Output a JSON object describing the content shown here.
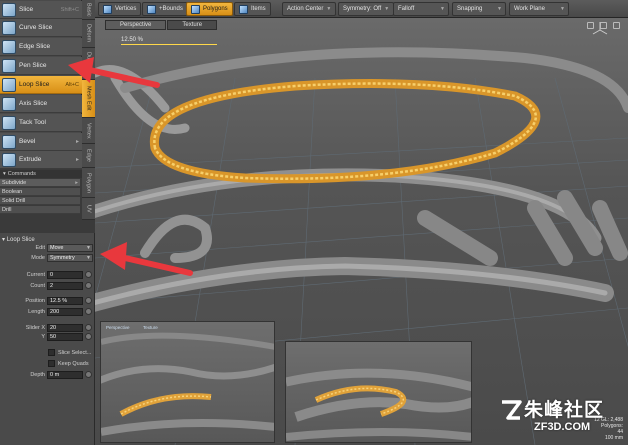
{
  "tools": [
    {
      "label": "Slice",
      "shortcut": "Shift+C"
    },
    {
      "label": "Curve Slice",
      "shortcut": ""
    },
    {
      "label": "Edge Slice",
      "shortcut": ""
    },
    {
      "label": "Pen Slice",
      "shortcut": ""
    },
    {
      "label": "Loop Slice",
      "shortcut": "Alt+C",
      "active": true
    },
    {
      "label": "Axis Slice",
      "shortcut": ""
    },
    {
      "label": "Tack Tool",
      "shortcut": ""
    },
    {
      "label": "Bevel",
      "shortcut": ""
    },
    {
      "label": "Extrude",
      "shortcut": ""
    }
  ],
  "tool_tabs": [
    "Basic",
    "Deform",
    "Duplicate",
    "Mesh Edit",
    "Vertex",
    "Edge",
    "Polygon",
    "UV"
  ],
  "commands": {
    "header": "Commands",
    "items": [
      "Subdivide",
      "Boolean",
      "Solid Drill",
      "Drill"
    ]
  },
  "properties": {
    "title": "Loop Slice",
    "edit_label": "Edit",
    "edit_value": "Move",
    "mode_label": "Mode",
    "mode_value": "Symmetry",
    "current_label": "Current",
    "current_value": "0",
    "count_label": "Count",
    "count_value": "2",
    "position_label": "Position",
    "position_value": "12.5 %",
    "length_label": "Length",
    "length_value": "200",
    "slider_x_label": "Slider X",
    "slider_x_value": "20",
    "slider_y_label": "Y",
    "slider_y_value": "50",
    "slice_select_label": "Slice Select...",
    "keep_quads_label": "Keep Quads",
    "depth_label": "Depth",
    "depth_value": "0 m"
  },
  "toolbar": {
    "vertices": "Vertices",
    "bounds": "+Bounds",
    "polygons": "Polygons",
    "items": "Items",
    "action_center": "Action Center",
    "symmetry": "Symmetry: Off",
    "falloff": "Falloff",
    "snapping": "Snapping",
    "work_plane": "Work Plane"
  },
  "viewport": {
    "tab_perspective": "Perspective",
    "tab_texture": "Texture",
    "slice_readout": "12.50 %",
    "inset_label": "Perspective",
    "inset_value": "Texture",
    "scale_lines": [
      "12 GL: 2,488",
      "Polygons:",
      "44",
      "100 mm"
    ]
  },
  "watermark": {
    "text": "朱峰社区",
    "url": "ZF3D.COM"
  },
  "colors": {
    "accent_orange": "#e8a22a",
    "annotation_red": "#e8383d",
    "panel_bg": "#4a4a4a",
    "selection_yellow": "#f0b62f"
  }
}
